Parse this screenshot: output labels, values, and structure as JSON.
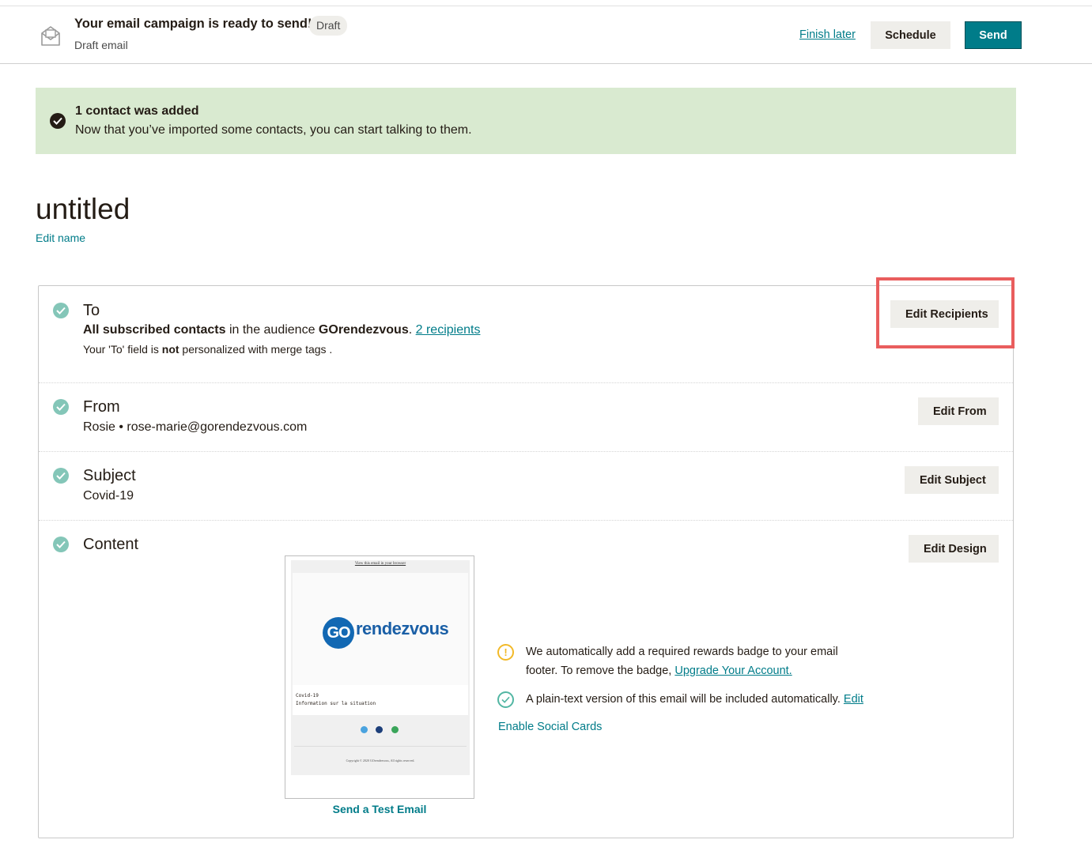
{
  "header": {
    "title": "Your email campaign is ready to send!",
    "badge": "Draft",
    "subtitle": "Draft email",
    "finish_later": "Finish later",
    "schedule": "Schedule",
    "send": "Send",
    "icon": "envelope-icon"
  },
  "alert": {
    "title": "1 contact was added",
    "body": "Now that you’ve imported some contacts, you can start talking to them.",
    "icon": "check-circle-icon",
    "background": "#d9ead0"
  },
  "campaign": {
    "name": "untitled",
    "edit_name": "Edit name"
  },
  "to": {
    "heading": "To",
    "all_subscribed": "All subscribed contacts",
    "in_audience": " in the audience ",
    "audience": "GOrendezvous",
    "period": ". ",
    "recipients_link": "2 recipients",
    "note_start": "Your 'To' field is ",
    "note_bold": "not",
    "note_end": " personalized with merge tags .",
    "button": "Edit Recipients"
  },
  "from": {
    "heading": "From",
    "value": "Rosie • rose-marie@gorendezvous.com",
    "button": "Edit From"
  },
  "subject": {
    "heading": "Subject",
    "value": "Covid-19",
    "button": "Edit Subject"
  },
  "content": {
    "heading": "Content",
    "button": "Edit Design",
    "preview": {
      "view_link": "View this email in your browser",
      "logo_go": "GO",
      "logo_text": "rendezvous",
      "subject": "Covid-19",
      "info": "Information sur la situation",
      "copyright": "Copyright © 2020 GOrendezvous, All rights reserved."
    },
    "send_test": "Send a Test Email",
    "badge_notice_1": "We automatically add a required rewards badge to your email",
    "badge_notice_2": "footer. To remove the badge, ",
    "upgrade_link": "Upgrade Your Account.",
    "plain_text_notice": "A plain-text version of this email will be included automatically. ",
    "plain_text_edit": "Edit",
    "enable_social": "Enable Social Cards"
  },
  "colors": {
    "accent": "#007c89",
    "check": "#84c6b8",
    "warning": "#f2b928",
    "highlight": "#e95d5d"
  }
}
